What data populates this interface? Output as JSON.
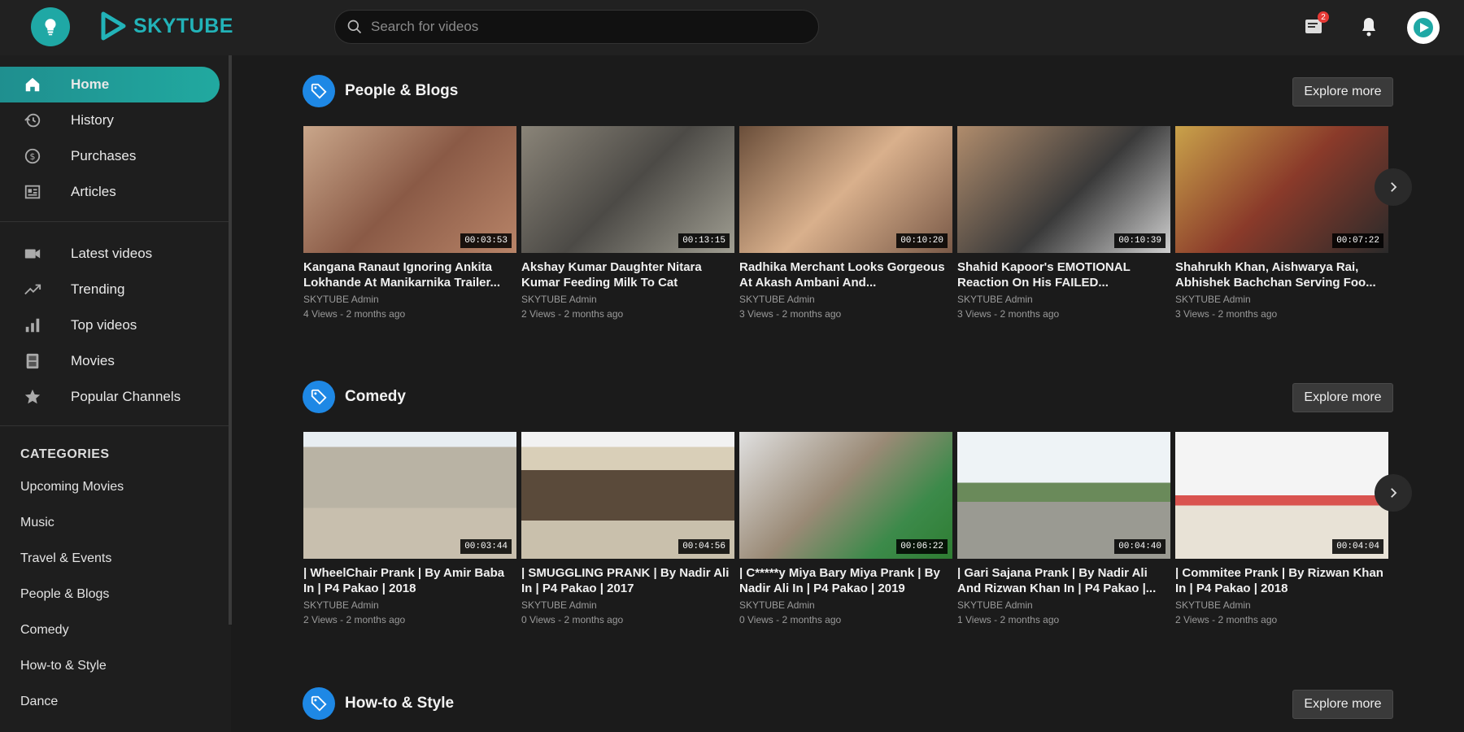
{
  "header": {
    "logo_text": "SKYTUBE",
    "search_placeholder": "Search for videos",
    "notif_badge": "2"
  },
  "sidebar": {
    "nav": [
      {
        "label": "Home",
        "icon": "home-icon"
      },
      {
        "label": "History",
        "icon": "history-icon"
      },
      {
        "label": "Purchases",
        "icon": "purchases-icon"
      },
      {
        "label": "Articles",
        "icon": "articles-icon"
      }
    ],
    "nav2": [
      {
        "label": "Latest videos",
        "icon": "video-camera-icon"
      },
      {
        "label": "Trending",
        "icon": "trending-icon"
      },
      {
        "label": "Top videos",
        "icon": "bar-chart-icon"
      },
      {
        "label": "Movies",
        "icon": "film-icon"
      },
      {
        "label": "Popular Channels",
        "icon": "star-icon"
      }
    ],
    "categories_heading": "CATEGORIES",
    "categories": [
      "Upcoming Movies",
      "Music",
      "Travel & Events",
      "People & Blogs",
      "Comedy",
      "How-to & Style",
      "Dance"
    ]
  },
  "sections": [
    {
      "title": "People & Blogs",
      "explore_label": "Explore more",
      "videos": [
        {
          "title": "Kangana Ranaut Ignoring Ankita Lokhande At Manikarnika Trailer...",
          "author": "SKYTUBE Admin",
          "meta": "4 Views - 2 months ago",
          "duration": "00:03:53"
        },
        {
          "title": "Akshay Kumar Daughter Nitara Kumar Feeding Milk To Cat",
          "author": "SKYTUBE Admin",
          "meta": "2 Views - 2 months ago",
          "duration": "00:13:15"
        },
        {
          "title": "Radhika Merchant Looks Gorgeous At Akash Ambani And...",
          "author": "SKYTUBE Admin",
          "meta": "3 Views - 2 months ago",
          "duration": "00:10:20"
        },
        {
          "title": "Shahid Kapoor's EMOTIONAL Reaction On His FAILED...",
          "author": "SKYTUBE Admin",
          "meta": "3 Views - 2 months ago",
          "duration": "00:10:39"
        },
        {
          "title": "Shahrukh Khan, Aishwarya Rai, Abhishek Bachchan Serving Foo...",
          "author": "SKYTUBE Admin",
          "meta": "3 Views - 2 months ago",
          "duration": "00:07:22"
        }
      ]
    },
    {
      "title": "Comedy",
      "explore_label": "Explore more",
      "videos": [
        {
          "title": "| WheelChair Prank | By Amir Baba In | P4 Pakao | 2018",
          "author": "SKYTUBE Admin",
          "meta": "2 Views - 2 months ago",
          "duration": "00:03:44"
        },
        {
          "title": "| SMUGGLING PRANK | By Nadir Ali In | P4 Pakao | 2017",
          "author": "SKYTUBE Admin",
          "meta": "0 Views - 2 months ago",
          "duration": "00:04:56"
        },
        {
          "title": "| C*****y Miya Bary Miya Prank | By Nadir Ali In | P4 Pakao | 2019",
          "author": "SKYTUBE Admin",
          "meta": "0 Views - 2 months ago",
          "duration": "00:06:22"
        },
        {
          "title": "| Gari Sajana Prank | By Nadir Ali And Rizwan Khan In | P4 Pakao |...",
          "author": "SKYTUBE Admin",
          "meta": "1 Views - 2 months ago",
          "duration": "00:04:40"
        },
        {
          "title": "| Commitee Prank | By Rizwan Khan In | P4 Pakao | 2018",
          "author": "SKYTUBE Admin",
          "meta": "2 Views - 2 months ago",
          "duration": "00:04:04"
        }
      ]
    },
    {
      "title": "How-to & Style",
      "explore_label": "Explore more",
      "videos": []
    }
  ],
  "colors": {
    "accent": "#1fa8a5",
    "tag": "#1e88e5",
    "background": "#1b1b1b"
  }
}
